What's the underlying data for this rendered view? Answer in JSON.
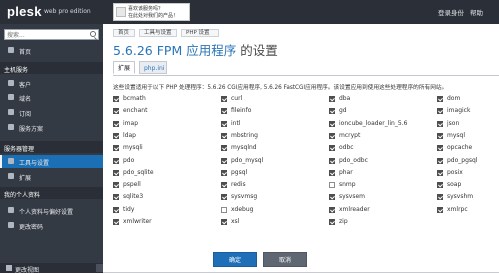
{
  "topbar": {
    "logo": "plesk",
    "edition": "web pro edition",
    "promo_line1": "喜欢该服务吗？",
    "promo_line2": "在此处对我们的产品！",
    "login_label": "登录身份",
    "help_label": "帮助"
  },
  "sidebar": {
    "search_placeholder": "搜索...",
    "home": "首页",
    "section_host": "主机服务",
    "host_items": [
      "客户",
      "域名",
      "订阅",
      "服务方案"
    ],
    "section_server": "服务器管理",
    "tools_label": "工具与设置",
    "extensions_label": "扩展",
    "section_profile": "我的个人资料",
    "profile_items": [
      "个人资料与偏好设置",
      "更改密码"
    ],
    "bottom_label": "更改视图"
  },
  "breadcrumb": [
    "首页",
    "工具与设置",
    "PHP 设置"
  ],
  "page": {
    "title_main": "5.6.26 FPM 应用程序",
    "title_sub": " 的设置",
    "tabs": [
      "扩展",
      "php.ini"
    ],
    "description": "这些设置适用于以下 PHP 处理程序：5.6.26 CGI应用程序, 5.6.26 FastCGI应用程序。该设置应用到使用这些处理程序的所有网站。"
  },
  "extensions": [
    {
      "name": "bcmath",
      "on": true
    },
    {
      "name": "curl",
      "on": true
    },
    {
      "name": "dba",
      "on": true
    },
    {
      "name": "dom",
      "on": true
    },
    {
      "name": "enchant",
      "on": true
    },
    {
      "name": "fileinfo",
      "on": true
    },
    {
      "name": "gd",
      "on": true
    },
    {
      "name": "imagick",
      "on": true
    },
    {
      "name": "imap",
      "on": true
    },
    {
      "name": "intl",
      "on": true
    },
    {
      "name": "ioncube_loader_lin_5.6",
      "on": true
    },
    {
      "name": "json",
      "on": true
    },
    {
      "name": "ldap",
      "on": true
    },
    {
      "name": "mbstring",
      "on": true
    },
    {
      "name": "mcrypt",
      "on": true
    },
    {
      "name": "mysql",
      "on": true
    },
    {
      "name": "mysqli",
      "on": true
    },
    {
      "name": "mysqlnd",
      "on": true
    },
    {
      "name": "odbc",
      "on": true
    },
    {
      "name": "opcache",
      "on": true
    },
    {
      "name": "pdo",
      "on": true
    },
    {
      "name": "pdo_mysql",
      "on": true
    },
    {
      "name": "pdo_odbc",
      "on": true
    },
    {
      "name": "pdo_pgsql",
      "on": true
    },
    {
      "name": "pdo_sqlite",
      "on": true
    },
    {
      "name": "pgsql",
      "on": true
    },
    {
      "name": "phar",
      "on": true
    },
    {
      "name": "posix",
      "on": true
    },
    {
      "name": "pspell",
      "on": true
    },
    {
      "name": "redis",
      "on": true
    },
    {
      "name": "snmp",
      "on": false
    },
    {
      "name": "soap",
      "on": true
    },
    {
      "name": "sqlite3",
      "on": true
    },
    {
      "name": "sysvmsg",
      "on": true
    },
    {
      "name": "sysvsem",
      "on": true
    },
    {
      "name": "sysvshm",
      "on": true
    },
    {
      "name": "tidy",
      "on": true
    },
    {
      "name": "xdebug",
      "on": false
    },
    {
      "name": "xmlreader",
      "on": true
    },
    {
      "name": "xmlrpc",
      "on": true
    },
    {
      "name": "xmlwriter",
      "on": true
    },
    {
      "name": "xsl",
      "on": true
    },
    {
      "name": "zip",
      "on": true
    }
  ],
  "buttons": {
    "ok": "确定",
    "cancel": "取消"
  },
  "colors": {
    "accent": "#1f6fb8",
    "sidebar": "#343a44",
    "topbar": "#2b2f38"
  }
}
